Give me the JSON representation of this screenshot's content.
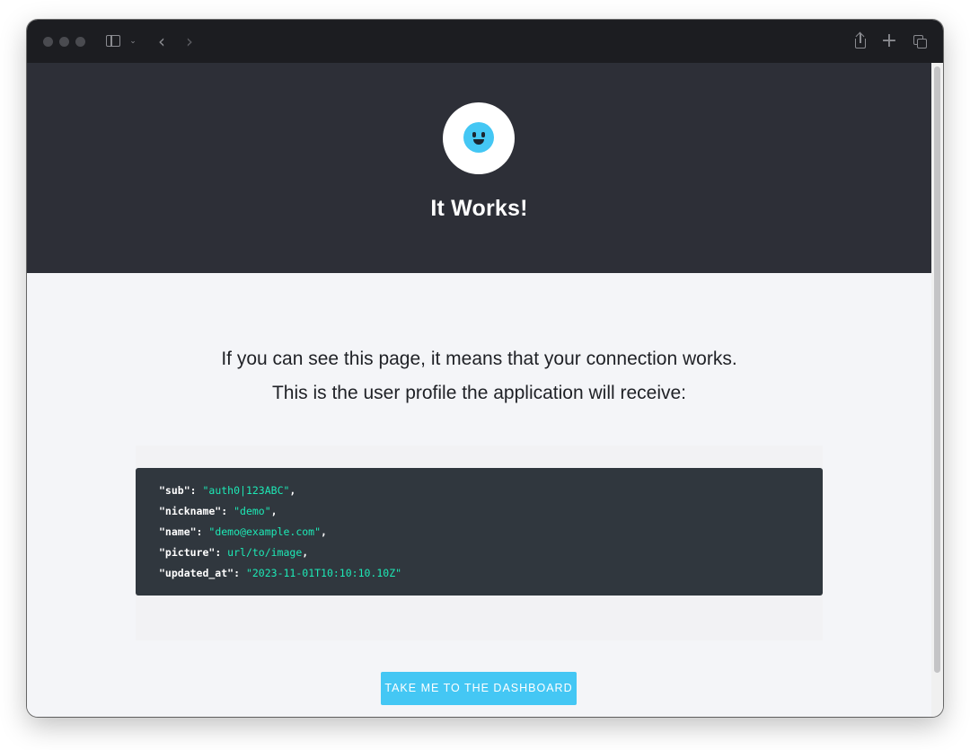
{
  "browser": {
    "toolbar_icons": [
      "sidebar-icon",
      "chevron-down-icon",
      "back-icon",
      "forward-icon",
      "share-icon",
      "new-tab-icon",
      "tabs-overview-icon"
    ]
  },
  "hero": {
    "logo_icon": "smiley-icon",
    "title": "It Works!",
    "background": "#2d2f37"
  },
  "content": {
    "intro_line_1": "If you can see this page, it means that your connection works.",
    "intro_line_2": "This is the user profile the application will receive:",
    "profile": [
      {
        "key": "\"sub\"",
        "value": "\"auth0|123ABC\"",
        "sep": ","
      },
      {
        "key": "\"nickname\"",
        "value": "\"demo\"",
        "sep": ","
      },
      {
        "key": "\"name\"",
        "value": "\"demo@example.com\"",
        "sep": ","
      },
      {
        "key": "\"picture\"",
        "value": "url/to/image",
        "sep": ","
      },
      {
        "key": "\"updated_at\"",
        "value": "\"2023-11-01T10:10:10.10Z\"",
        "sep": ""
      }
    ],
    "cta_label": "TAKE ME TO THE DASHBOARD"
  },
  "colors": {
    "accent": "#44c7f4",
    "code_value": "#1de9b6",
    "code_background": "#30373e"
  }
}
